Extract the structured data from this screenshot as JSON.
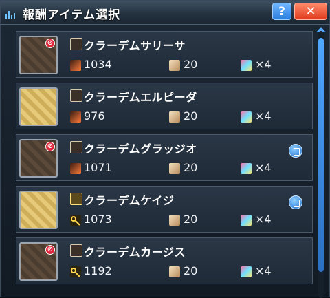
{
  "window": {
    "title": "報酬アイテム選択",
    "help_label": "?",
    "close_label": "✕"
  },
  "items": [
    {
      "name": "クラーデムサリーサ",
      "atk": "1034",
      "grind": "20",
      "slots": "×4",
      "type_icon": "sword-icon",
      "thumb": "dark",
      "restricted": true,
      "memo": false
    },
    {
      "name": "クラーデムエルピーダ",
      "atk": "976",
      "grind": "20",
      "slots": "×4",
      "type_icon": "sword-icon",
      "thumb": "gold",
      "restricted": false,
      "memo": false
    },
    {
      "name": "クラーデムグラッジオ",
      "atk": "1071",
      "grind": "20",
      "slots": "×4",
      "type_icon": "sword-icon",
      "thumb": "dark",
      "restricted": true,
      "memo": true
    },
    {
      "name": "クラーデムケイジ",
      "atk": "1073",
      "grind": "20",
      "slots": "×4",
      "type_icon": "launcher-icon",
      "thumb": "gold",
      "restricted": false,
      "memo": true
    },
    {
      "name": "クラーデムカージス",
      "atk": "1192",
      "grind": "20",
      "slots": "×4",
      "type_icon": "bow-icon",
      "thumb": "dark",
      "restricted": true,
      "memo": false
    }
  ],
  "restricted_mark": "⊘",
  "colors": {
    "accent": "#2a7de0",
    "close": "#e03a1e",
    "panel": "#1f2a37"
  }
}
